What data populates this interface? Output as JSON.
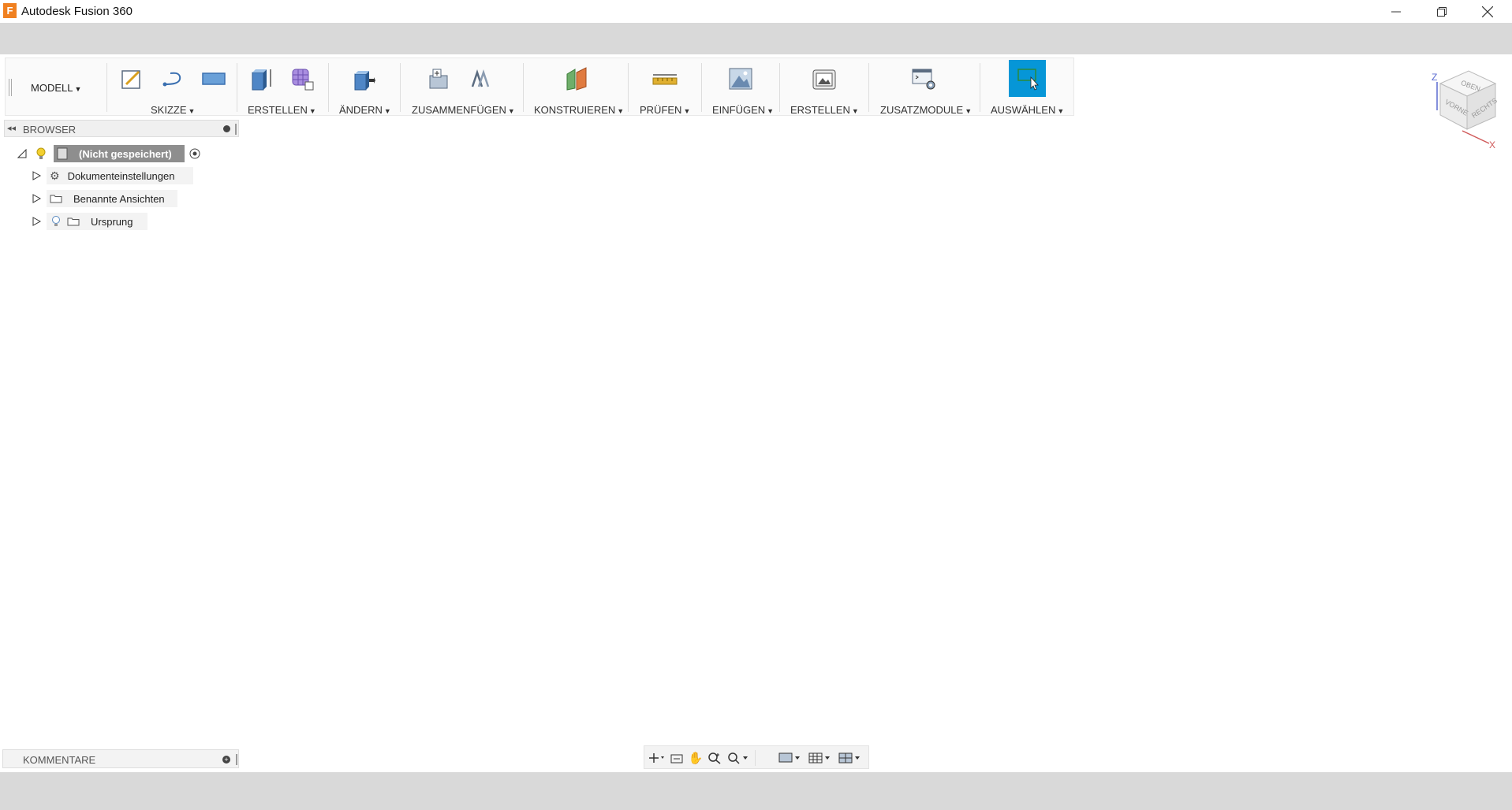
{
  "window": {
    "title": "Autodesk Fusion 360",
    "logo_letter": "F"
  },
  "toolbar": {
    "workspace": "MODELL",
    "groups": [
      {
        "label": "SKIZZE"
      },
      {
        "label": "ERSTELLEN"
      },
      {
        "label": "ÄNDERN"
      },
      {
        "label": "ZUSAMMENFÜGEN"
      },
      {
        "label": "KONSTRUIEREN"
      },
      {
        "label": "PRÜFEN"
      },
      {
        "label": "EINFÜGEN"
      },
      {
        "label": "ERSTELLEN"
      },
      {
        "label": "ZUSATZMODULE"
      },
      {
        "label": "AUSWÄHLEN"
      }
    ]
  },
  "browser": {
    "title": "BROWSER",
    "root": "(Nicht gespeichert)",
    "items": [
      {
        "label": "Dokumenteinstellungen",
        "icon": "gear-icon"
      },
      {
        "label": "Benannte Ansichten",
        "icon": "folder-icon"
      },
      {
        "label": "Ursprung",
        "icon": "folder-icon"
      }
    ]
  },
  "comments": {
    "title": "KOMMENTARE"
  },
  "viewcube": {
    "faces": [
      "OBEN",
      "VORNE",
      "RECHTS"
    ],
    "axes": [
      "Z",
      "X"
    ]
  },
  "colors": {
    "accent_select": "#0696d7",
    "logo": "#f08020",
    "band": "#d9d9d9"
  }
}
